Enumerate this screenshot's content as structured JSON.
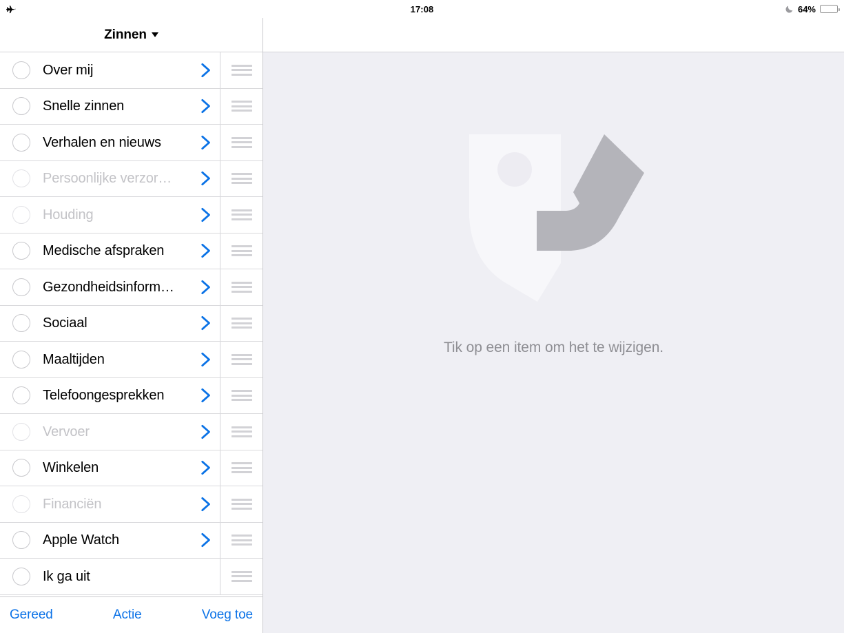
{
  "status_bar": {
    "airplane_icon": "airplane-mode-icon",
    "time": "17:08",
    "dnd_icon": "moon-do-not-disturb-icon",
    "battery_percent": "64%",
    "battery_level": 64
  },
  "colors": {
    "accent_blue": "#0b72e7",
    "chevron_blue": "#0a72e6",
    "detail_background": "#efeff4",
    "dim_text": "#c3c3c7",
    "placeholder_text": "#8e8e93",
    "separator": "#d9d9dc",
    "logo_light": "#f7f7fa",
    "logo_gray": "#b4b4ba"
  },
  "sidebar": {
    "title": "Zinnen",
    "title_caret_icon": "chevron-down-icon",
    "rows": [
      {
        "label": "Over mij",
        "dim": false,
        "chevron": true,
        "radio_icon": "radio-circle-icon",
        "handle_icon": "reorder-handle-icon",
        "chevron_icon": "chevron-right-icon"
      },
      {
        "label": "Snelle zinnen",
        "dim": false,
        "chevron": true,
        "radio_icon": "radio-circle-icon",
        "handle_icon": "reorder-handle-icon",
        "chevron_icon": "chevron-right-icon"
      },
      {
        "label": "Verhalen en nieuws",
        "dim": false,
        "chevron": true,
        "radio_icon": "radio-circle-icon",
        "handle_icon": "reorder-handle-icon",
        "chevron_icon": "chevron-right-icon"
      },
      {
        "label": "Persoonlijke verzor…",
        "dim": true,
        "chevron": true,
        "radio_icon": "radio-circle-icon",
        "handle_icon": "reorder-handle-icon",
        "chevron_icon": "chevron-right-icon"
      },
      {
        "label": "Houding",
        "dim": true,
        "chevron": true,
        "radio_icon": "radio-circle-icon",
        "handle_icon": "reorder-handle-icon",
        "chevron_icon": "chevron-right-icon"
      },
      {
        "label": "Medische afspraken",
        "dim": false,
        "chevron": true,
        "radio_icon": "radio-circle-icon",
        "handle_icon": "reorder-handle-icon",
        "chevron_icon": "chevron-right-icon"
      },
      {
        "label": "Gezondheidsinform…",
        "dim": false,
        "chevron": true,
        "radio_icon": "radio-circle-icon",
        "handle_icon": "reorder-handle-icon",
        "chevron_icon": "chevron-right-icon"
      },
      {
        "label": "Sociaal",
        "dim": false,
        "chevron": true,
        "radio_icon": "radio-circle-icon",
        "handle_icon": "reorder-handle-icon",
        "chevron_icon": "chevron-right-icon"
      },
      {
        "label": "Maaltijden",
        "dim": false,
        "chevron": true,
        "radio_icon": "radio-circle-icon",
        "handle_icon": "reorder-handle-icon",
        "chevron_icon": "chevron-right-icon"
      },
      {
        "label": "Telefoongesprekken",
        "dim": false,
        "chevron": true,
        "radio_icon": "radio-circle-icon",
        "handle_icon": "reorder-handle-icon",
        "chevron_icon": "chevron-right-icon"
      },
      {
        "label": "Vervoer",
        "dim": true,
        "chevron": true,
        "radio_icon": "radio-circle-icon",
        "handle_icon": "reorder-handle-icon",
        "chevron_icon": "chevron-right-icon"
      },
      {
        "label": "Winkelen",
        "dim": false,
        "chevron": true,
        "radio_icon": "radio-circle-icon",
        "handle_icon": "reorder-handle-icon",
        "chevron_icon": "chevron-right-icon"
      },
      {
        "label": "Financiën",
        "dim": true,
        "chevron": true,
        "radio_icon": "radio-circle-icon",
        "handle_icon": "reorder-handle-icon",
        "chevron_icon": "chevron-right-icon"
      },
      {
        "label": "Apple Watch",
        "dim": false,
        "chevron": true,
        "radio_icon": "radio-circle-icon",
        "handle_icon": "reorder-handle-icon",
        "chevron_icon": "chevron-right-icon"
      },
      {
        "label": "Ik ga uit",
        "dim": false,
        "chevron": false,
        "radio_icon": "radio-circle-icon",
        "handle_icon": "reorder-handle-icon",
        "chevron_icon": ""
      }
    ],
    "toolbar": {
      "done_label": "Gereed",
      "action_label": "Actie",
      "add_label": "Voeg toe"
    }
  },
  "detail": {
    "logo_icon": "app-face-logo-icon",
    "placeholder_message": "Tik op een item om het te wijzigen."
  }
}
